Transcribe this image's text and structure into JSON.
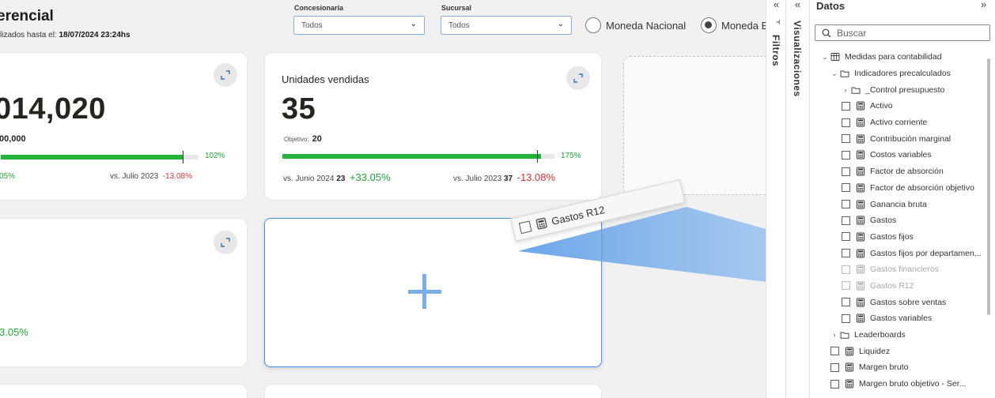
{
  "report": {
    "title": "erencial",
    "subtitle_prefix": "lizados hasta el:",
    "subtitle_date": "18/07/2024 23:24hs"
  },
  "slicers": {
    "concesionaria": {
      "label": "Concesionaria",
      "value": "Todos"
    },
    "sucursal": {
      "label": "Sucursal",
      "value": "Todos"
    }
  },
  "currency": {
    "options": [
      {
        "label": "Moneda Nacional",
        "selected": false
      },
      {
        "label": "Moneda E",
        "selected": true
      }
    ]
  },
  "cards": {
    "card1": {
      "value": "014,020",
      "target_value": "00,000",
      "progress_pct": 102,
      "progress_label": "102%",
      "cmp1_change": "05%",
      "cmp2_label": "vs. Julio 2023",
      "cmp2_change": "-13.08%"
    },
    "card2": {
      "title": "Unidades vendidas",
      "value": "35",
      "target_label": "Objetivo:",
      "target_value": "20",
      "progress_pct": 175,
      "progress_label": "175%",
      "cmp1_label": "vs. Junio 2024",
      "cmp1_value": "23",
      "cmp1_change": "+33.05%",
      "cmp2_label": "vs. Julio 2023",
      "cmp2_value": "37",
      "cmp2_change": "-13.08%"
    },
    "card3": {
      "change": "3.05%"
    }
  },
  "drag_item": {
    "label": "Gastos R12"
  },
  "panes": {
    "filtros": {
      "label": "Filtros",
      "collapse": "«"
    },
    "visualizaciones": {
      "label": "Visualizaciones",
      "collapse": "«"
    },
    "datos": {
      "title": "Datos",
      "expand": "»",
      "search_placeholder": "Buscar",
      "tree": [
        {
          "level": 0,
          "kind": "table",
          "label": "Medidas para contabilidad",
          "chev": "⌄"
        },
        {
          "level": 1,
          "kind": "folder",
          "label": "Indicadores precalculados",
          "chev": "⌄"
        },
        {
          "level": 2,
          "kind": "folder",
          "label": "_Control presupuesto",
          "chev": "›"
        },
        {
          "level": 2,
          "kind": "measure",
          "label": "Activo"
        },
        {
          "level": 2,
          "kind": "measure",
          "label": "Activo corriente"
        },
        {
          "level": 2,
          "kind": "measure",
          "label": "Contribución marginal"
        },
        {
          "level": 2,
          "kind": "measure",
          "label": "Costos variables"
        },
        {
          "level": 2,
          "kind": "measure",
          "label": "Factor de absorción"
        },
        {
          "level": 2,
          "kind": "measure",
          "label": "Factor de absorción objetivo"
        },
        {
          "level": 2,
          "kind": "measure",
          "label": "Ganancia bruta"
        },
        {
          "level": 2,
          "kind": "measure",
          "label": "Gastos"
        },
        {
          "level": 2,
          "kind": "measure",
          "label": "Gastos fijos"
        },
        {
          "level": 2,
          "kind": "measure",
          "label": "Gastos fijos por departamen..."
        },
        {
          "level": 2,
          "kind": "measure",
          "label": "Gastos financieros",
          "dim": true
        },
        {
          "level": 2,
          "kind": "measure",
          "label": "Gastos R12",
          "dim": true
        },
        {
          "level": 2,
          "kind": "measure",
          "label": "Gastos sobre ventas"
        },
        {
          "level": 2,
          "kind": "measure",
          "label": "Gastos variables"
        },
        {
          "level": 1,
          "kind": "folder",
          "label": "Leaderboards",
          "chev": "›"
        },
        {
          "level": 1,
          "kind": "measure",
          "label": "Liquidez"
        },
        {
          "level": 1,
          "kind": "measure",
          "label": "Margen bruto"
        },
        {
          "level": 1,
          "kind": "measure",
          "label": "Margen bruto objetivo - Ser..."
        }
      ]
    }
  },
  "colors": {
    "progress": "#22b33a",
    "positive": "#22a33a",
    "negative": "#d13438",
    "accent": "#4a90e2"
  }
}
